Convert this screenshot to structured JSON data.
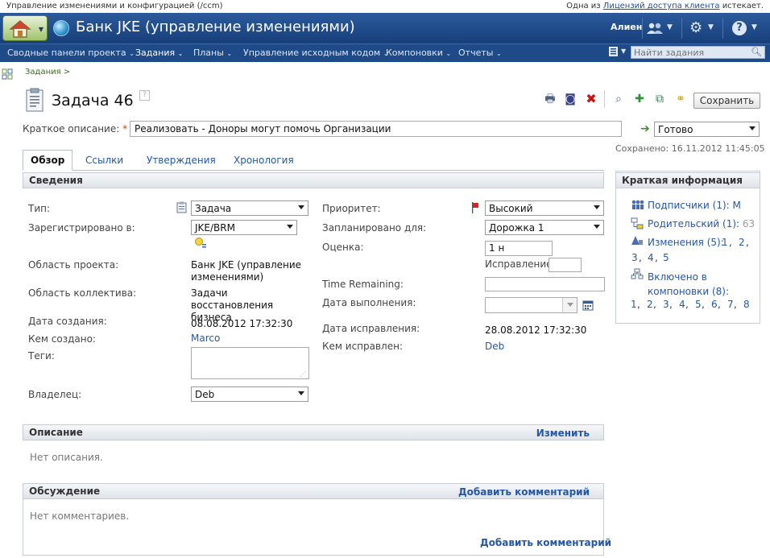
{
  "topbar": {
    "context": "Управление изменениями и конфигурацией (/ccm)",
    "license_prefix": "Одна из",
    "license_link": "Лицензий доступа клиента",
    "license_suffix": "истекает."
  },
  "header": {
    "title": "Банк JKE (управление изменениями)",
    "user": "Алиен",
    "icons": [
      "home-icon",
      "globe-icon",
      "users-icon",
      "gear-icon",
      "help-icon"
    ]
  },
  "nav": {
    "items": [
      {
        "label": "Сводные панели проекта"
      },
      {
        "label": "Задания"
      },
      {
        "label": "Планы"
      },
      {
        "label": "Управление исходным кодом"
      },
      {
        "label": "Компоновки"
      },
      {
        "label": "Отчеты"
      }
    ],
    "search_placeholder": "Найти задания"
  },
  "breadcrumb": "Задания >",
  "work_item": {
    "title": "Задача 46",
    "save_label": "Сохранить",
    "summary_label": "Краткое описание:",
    "summary_required": "*",
    "summary_value": "Реализовать - Доноры могут помочь Организации",
    "status": "Готово",
    "saved": "Сохранено: 16.11.2012 11:45:05"
  },
  "tabs": [
    {
      "label": "Обзор"
    },
    {
      "label": "Ссылки"
    },
    {
      "label": "Утверждения"
    },
    {
      "label": "Хронология"
    }
  ],
  "details": {
    "header": "Сведения",
    "type_label": "Тип:",
    "type_value": "Задача",
    "filed_against_label": "Зарегистрировано в:",
    "filed_against_value": "JKE/BRM",
    "project_area_label": "Область проекта:",
    "project_area_value": "Банк JKE (управление изменениями)",
    "team_area_label": "Область коллектива:",
    "team_area_value": "Задачи восстановления бизнеса",
    "created_date_label": "Дата создания:",
    "created_date_value": "08.08.2012 17:32:30",
    "created_by_label": "Кем создано:",
    "created_by_value": "Marco",
    "tags_label": "Теги:",
    "owner_label": "Владелец:",
    "owner_value": "Deb",
    "priority_label": "Приоритет:",
    "priority_value": "Высокий",
    "planned_for_label": "Запланировано для:",
    "planned_for_value": "Дорожка 1",
    "estimate_label": "Оценка:",
    "estimate_value": "1 н",
    "correction_label": "Исправление",
    "time_remaining_label": "Time Remaining:",
    "due_date_label": "Дата выполнения:",
    "resolution_date_label": "Дата исправления:",
    "resolution_date_value": "28.08.2012 17:32:30",
    "resolved_by_label": "Кем исправлен:",
    "resolved_by_value": "Deb"
  },
  "quick_info": {
    "header": "Краткая информация",
    "subscribers": "Подписчики (1):",
    "subscribers_value": "M",
    "parent": "Родительский (1):",
    "parent_value": "63",
    "changes": "Изменения (5):",
    "changes_links": [
      "1",
      "2",
      "3",
      "4",
      "5"
    ],
    "included_in_builds": "Включено в компоновки (8):",
    "builds_links": [
      "1",
      "2",
      "3",
      "4",
      "5",
      "6",
      "7",
      "8"
    ]
  },
  "description": {
    "header": "Описание",
    "action": "Изменить",
    "empty": "Нет описания."
  },
  "discussion": {
    "header": "Обсуждение",
    "action": "Добавить комментарий",
    "empty": "Нет комментариев.",
    "action_bottom": "Добавить комментарий"
  },
  "colors": {
    "header_bg": "#1e4a88",
    "link": "#2457a6",
    "required": "#d04000"
  }
}
